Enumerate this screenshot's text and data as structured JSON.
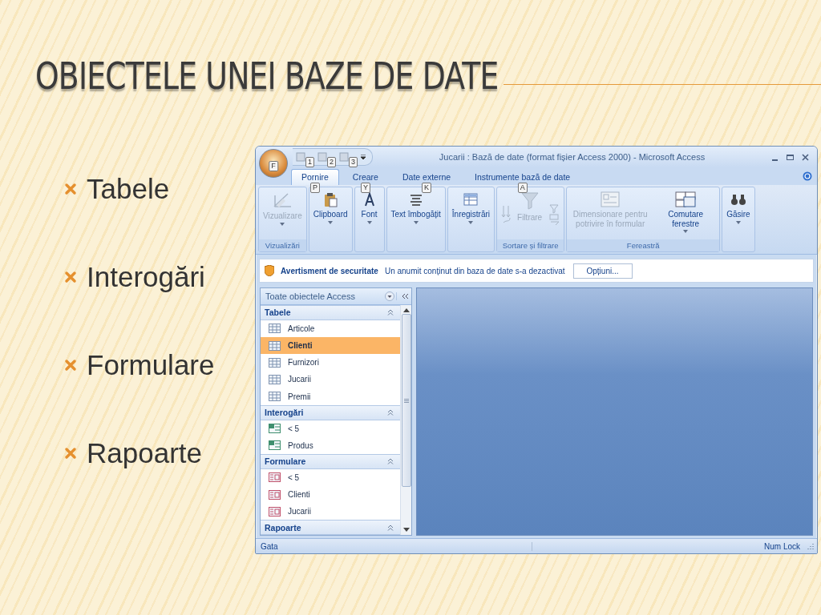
{
  "slide": {
    "title": "OBIECTELE UNEI BAZE DE DATE",
    "bullets": [
      "Tabele",
      "Interogări",
      "Formulare",
      "Rapoarte"
    ]
  },
  "window": {
    "title": "Jucarii : Bază de date (format fișier Access 2000) - Microsoft Access",
    "office_keytip": "F",
    "quick_access_keytips": [
      "1",
      "2",
      "3"
    ]
  },
  "tabs": [
    {
      "label": "Pornire",
      "keytip": "P",
      "selected": true
    },
    {
      "label": "Creare",
      "keytip": "Y",
      "selected": false
    },
    {
      "label": "Date externe",
      "keytip": "K",
      "selected": false
    },
    {
      "label": "Instrumente bază de date",
      "keytip": "A",
      "selected": false
    }
  ],
  "ribbon_groups": [
    {
      "label": "Vizualizări",
      "buttons": [
        {
          "kind": "view",
          "label": "Vizualizare",
          "disabled": true,
          "dropdown": true
        }
      ]
    },
    {
      "buttons": [
        {
          "kind": "clipboard",
          "label": "Clipboard",
          "disabled": false,
          "dropdown": true
        }
      ]
    },
    {
      "buttons": [
        {
          "kind": "font",
          "label": "Font",
          "disabled": false,
          "dropdown": true
        }
      ]
    },
    {
      "buttons": [
        {
          "kind": "richtext",
          "label": "Text îmbogățit",
          "disabled": false,
          "dropdown": true
        }
      ]
    },
    {
      "buttons": [
        {
          "kind": "records",
          "label": "Înregistrări",
          "disabled": false,
          "dropdown": true
        }
      ]
    },
    {
      "label": "Sortare și filtrare",
      "buttons": [
        {
          "kind": "sort",
          "disabled": true
        },
        {
          "kind": "filter",
          "label": "Filtrare",
          "disabled": true,
          "dropdown": false
        },
        {
          "kind": "filter-tools",
          "disabled": true
        }
      ]
    },
    {
      "label": "Fereastră",
      "buttons": [
        {
          "kind": "resize",
          "label": "Dimensionare pentru potrivire în formular",
          "disabled": true,
          "dropdown": false
        },
        {
          "kind": "switch",
          "label": "Comutare ferestre",
          "disabled": false,
          "dropdown": true
        }
      ]
    },
    {
      "buttons": [
        {
          "kind": "find",
          "label": "Găsire",
          "disabled": false,
          "dropdown": true
        }
      ]
    }
  ],
  "security_bar": {
    "title": "Avertisment de securitate",
    "message": "Un anumit conținut din baza de date s-a dezactivat",
    "button": "Opțiuni..."
  },
  "nav_pane": {
    "title": "Toate obiectele Access",
    "groups": [
      {
        "label": "Tabele",
        "items": [
          {
            "label": "Articole",
            "kind": "table",
            "selected": false
          },
          {
            "label": "Clienti",
            "kind": "table",
            "selected": true
          },
          {
            "label": "Furnizori",
            "kind": "table",
            "selected": false
          },
          {
            "label": "Jucarii",
            "kind": "table",
            "selected": false
          },
          {
            "label": "Premii",
            "kind": "table",
            "selected": false
          }
        ]
      },
      {
        "label": "Interogări",
        "items": [
          {
            "label": "< 5",
            "kind": "query",
            "selected": false
          },
          {
            "label": "Produs",
            "kind": "query",
            "selected": false
          }
        ]
      },
      {
        "label": "Formulare",
        "items": [
          {
            "label": "< 5",
            "kind": "form",
            "selected": false
          },
          {
            "label": "Clienti",
            "kind": "form",
            "selected": false
          },
          {
            "label": "Jucarii",
            "kind": "form",
            "selected": false
          }
        ]
      },
      {
        "label": "Rapoarte"
      }
    ]
  },
  "status_bar": {
    "left": "Gata",
    "right": "Num Lock"
  }
}
